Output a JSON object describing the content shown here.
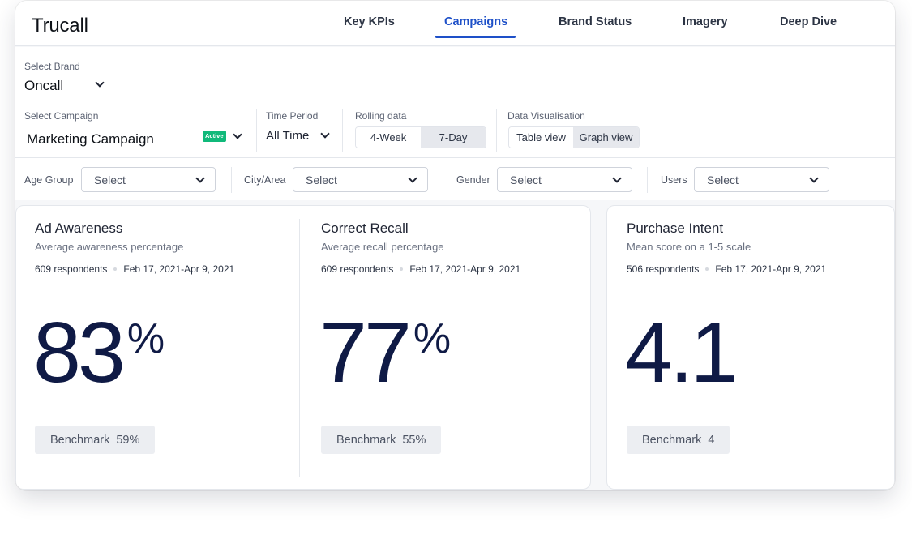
{
  "app": {
    "title": "Trucall"
  },
  "nav": {
    "items": [
      {
        "label": "Key KPIs"
      },
      {
        "label": "Campaigns"
      },
      {
        "label": "Brand Status"
      },
      {
        "label": "Imagery"
      },
      {
        "label": "Deep Dive"
      }
    ],
    "active": "Campaigns"
  },
  "filters": {
    "brand": {
      "label": "Select Brand",
      "value": "Oncall"
    },
    "campaign": {
      "label": "Select Campaign",
      "value": "Marketing Campaign",
      "badge": "Active"
    },
    "time_period": {
      "label": "Time Period",
      "value": "All Time"
    },
    "rolling": {
      "label": "Rolling data",
      "options": [
        "4-Week",
        "7-Day"
      ],
      "selected": "7-Day"
    },
    "visualisation": {
      "label": "Data Visualisation",
      "options": [
        "Table view",
        "Graph view"
      ],
      "selected": "Graph view"
    },
    "age_group": {
      "label": "Age Group",
      "value": "Select"
    },
    "city_area": {
      "label": "City/Area",
      "value": "Select"
    },
    "gender": {
      "label": "Gender",
      "value": "Select"
    },
    "users": {
      "label": "Users",
      "value": "Select"
    }
  },
  "metrics": [
    {
      "title": "Ad Awareness",
      "subtitle": "Average awareness percentage",
      "respondents": "609 respondents",
      "date_range": "Feb 17, 2021-Apr 9, 2021",
      "value": "83",
      "unit": "%",
      "benchmark_label": "Benchmark",
      "benchmark_value": "59%"
    },
    {
      "title": "Correct Recall",
      "subtitle": "Average recall percentage",
      "respondents": "609 respondents",
      "date_range": "Feb 17, 2021-Apr 9, 2021",
      "value": "77",
      "unit": "%",
      "benchmark_label": "Benchmark",
      "benchmark_value": "55%"
    },
    {
      "title": "Purchase Intent",
      "subtitle": "Mean score on a 1-5 scale",
      "respondents": "506 respondents",
      "date_range": "Feb 17, 2021-Apr 9, 2021",
      "value": "4.1",
      "unit": "",
      "benchmark_label": "Benchmark",
      "benchmark_value": "4"
    }
  ],
  "colors": {
    "accent": "#1e50c8",
    "active_badge": "#10b97a",
    "big_number": "#0f1a45"
  }
}
